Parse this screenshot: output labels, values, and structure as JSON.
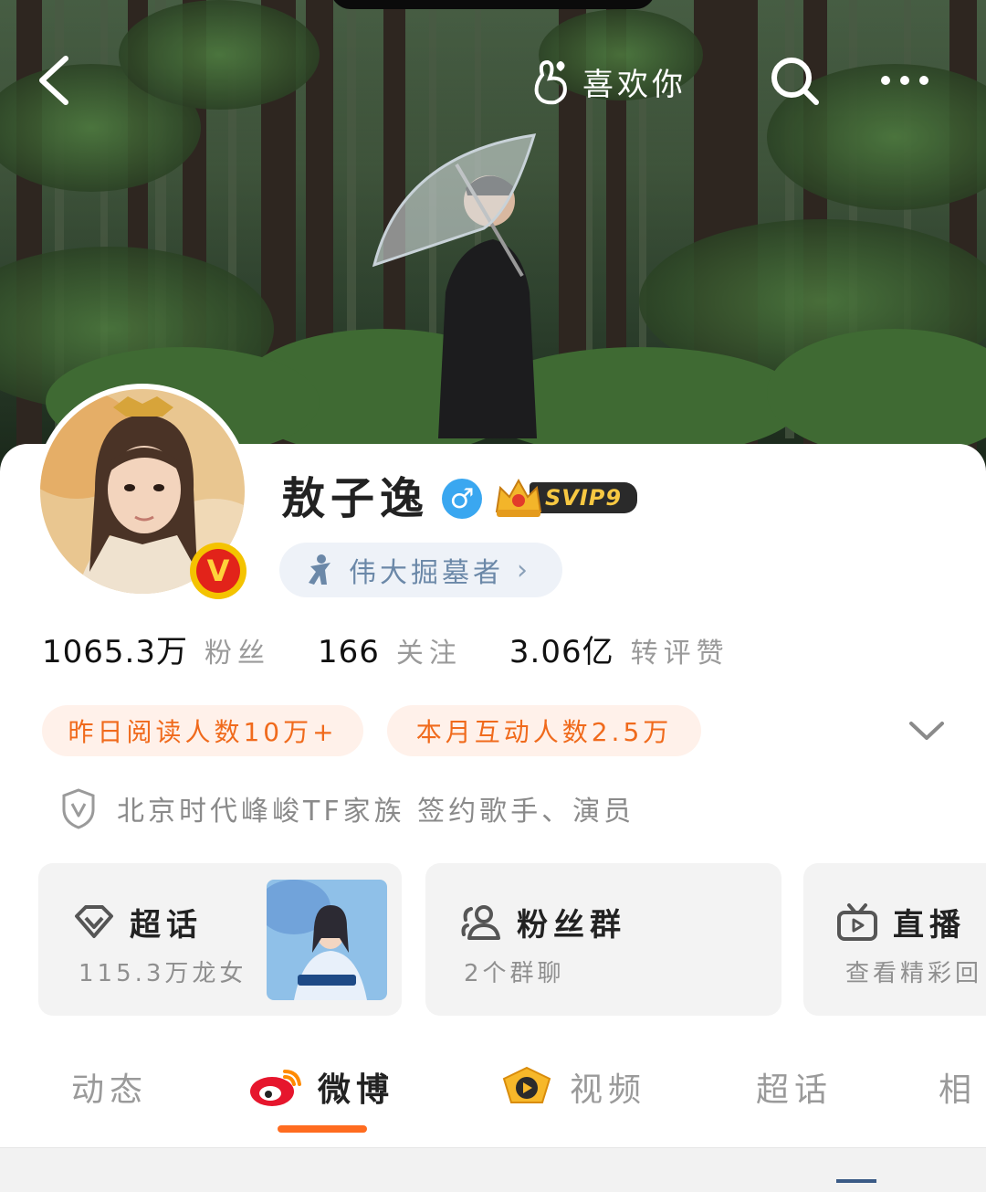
{
  "header": {
    "like_label": "喜欢你",
    "icons": [
      "back-arrow-icon",
      "finger-heart-icon",
      "search-icon",
      "more-icon"
    ]
  },
  "profile": {
    "name": "敖子逸",
    "gender_symbol": "♂",
    "vip_label": "SVIP9",
    "badge_letter": "V",
    "title_label": "伟大掘墓者",
    "title_chevron": "›"
  },
  "stats": [
    {
      "value": "1065.3万",
      "label": "粉丝"
    },
    {
      "value": "166",
      "label": "关注"
    },
    {
      "value": "3.06亿",
      "label": "转评赞"
    }
  ],
  "chips": [
    {
      "label": "昨日阅读人数10万+"
    },
    {
      "label": "本月互动人数2.5万"
    }
  ],
  "verification": {
    "text": "北京时代峰峻TF家族 签约歌手、演员",
    "icon": "shield-v-icon"
  },
  "features": [
    {
      "title": "超话",
      "subtitle": "115.3万龙女",
      "icon": "diamond-icon"
    },
    {
      "title": "粉丝群",
      "subtitle": "2个群聊",
      "icon": "group-icon"
    },
    {
      "title": "直播",
      "subtitle": "查看精彩回",
      "icon": "tv-icon"
    }
  ],
  "tabs": [
    {
      "label": "动态"
    },
    {
      "label": "微博"
    },
    {
      "label": "视频"
    },
    {
      "label": "超话"
    },
    {
      "label": "相"
    }
  ],
  "colors": {
    "accent": "#ff6c20",
    "chip_bg": "#fff1ea",
    "chip_text": "#f06a1c",
    "title_pill_bg": "#eef2f8",
    "gender_blue": "#3aa7f0"
  }
}
